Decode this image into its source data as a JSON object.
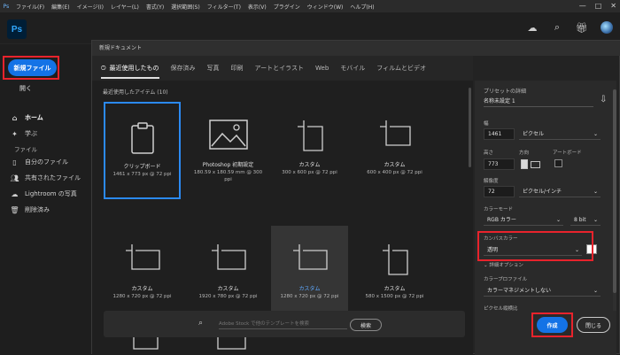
{
  "menubar": {
    "app_icon": "Ps",
    "items": [
      "ファイル(F)",
      "編集(E)",
      "イメージ(I)",
      "レイヤー(L)",
      "書式(Y)",
      "選択範囲(S)",
      "フィルター(T)",
      "表示(V)",
      "プラグイン",
      "ウィンドウ(W)",
      "ヘルプ(H)"
    ],
    "window_controls": [
      "—",
      "□",
      "✕"
    ]
  },
  "header": {
    "logo": "Ps"
  },
  "leftnav": {
    "new_file": "新規ファイル",
    "open": "開く",
    "items": [
      {
        "label": "ホーム",
        "icon": "home-icon"
      },
      {
        "label": "学ぶ",
        "icon": "learn-icon"
      },
      {
        "label": "ファイル",
        "icon": ""
      },
      {
        "label": "自分のファイル",
        "icon": "file-icon"
      },
      {
        "label": "共有されたファイル",
        "icon": "shared-icon"
      },
      {
        "label": "Lightroom の写真",
        "icon": "cloud-icon"
      },
      {
        "label": "削除済み",
        "icon": "trash-icon"
      }
    ]
  },
  "dialog": {
    "title": "新規ドキュメント",
    "tabs": [
      "最近使用したもの",
      "保存済み",
      "写真",
      "印刷",
      "アートとイラスト",
      "Web",
      "モバイル",
      "フィルムとビデオ"
    ],
    "section_title": "最近使用したアイテム (10)",
    "presets": [
      {
        "name": "クリップボード",
        "meta": "1461 x 773 px @ 72 ppi",
        "type": "clipboard"
      },
      {
        "name": "Photoshop 初期設定",
        "meta": "180.59 x 180.59 mm @ 300 ppi",
        "type": "image"
      },
      {
        "name": "カスタム",
        "meta": "300 x 600 px @ 72 ppi",
        "type": "doc"
      },
      {
        "name": "カスタム",
        "meta": "600 x 400 px @ 72 ppi",
        "type": "doc"
      },
      {
        "name": "カスタム",
        "meta": "1280 x 720 px @ 72 ppi",
        "type": "doc"
      },
      {
        "name": "カスタム",
        "meta": "1920 x 780 px @ 72 ppi",
        "type": "doc"
      },
      {
        "name": "カスタム",
        "meta": "1280 x 720 px @ 72 ppi",
        "type": "doc"
      },
      {
        "name": "カスタム",
        "meta": "580 x 1500 px @ 72 ppi",
        "type": "doc"
      },
      {
        "name": "",
        "meta": "",
        "type": "doc"
      },
      {
        "name": "",
        "meta": "",
        "type": "doc"
      }
    ],
    "search_placeholder": "Adobe Stock で他のテンプレートを検索",
    "search_button": "検索"
  },
  "preset_details": {
    "title": "プリセットの詳細",
    "name": "名称未設定 1",
    "width_label": "幅",
    "width_value": "1461",
    "width_unit": "ピクセル",
    "height_label": "高さ",
    "height_value": "773",
    "orientation_label": "方向",
    "artboard_label": "アートボード",
    "resolution_label": "解像度",
    "resolution_value": "72",
    "resolution_unit": "ピクセル/インチ",
    "color_mode_label": "カラーモード",
    "color_mode_value": "RGB カラー",
    "bit_depth": "8 bit",
    "canvas_color_label": "カンバスカラー",
    "canvas_color_value": "透明",
    "advanced_label": "詳細オプション",
    "color_profile_label": "カラープロファイル",
    "color_profile_value": "カラーマネジメントしない",
    "pixel_ratio_label": "ピクセル縦横比",
    "create_button": "作成",
    "close_button": "閉じる"
  },
  "colors": {
    "accent": "#1473e6",
    "highlight": "#e8232c",
    "selected": "#2b8af3"
  }
}
